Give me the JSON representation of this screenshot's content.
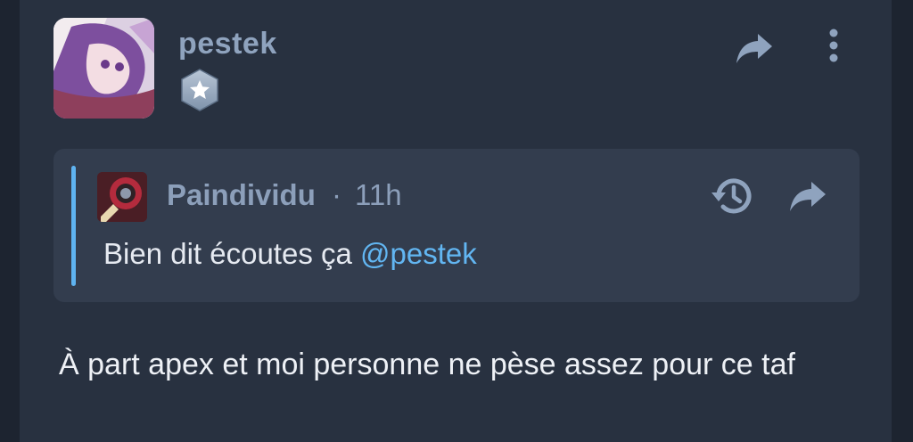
{
  "post": {
    "username": "pestek",
    "badge_icon": "star-badge-icon",
    "share_icon": "share-arrow-icon",
    "more_icon": "more-vertical-icon",
    "body": "À part apex et moi personne ne pèse assez pour ce taf"
  },
  "quote": {
    "author": "Paindividu",
    "separator": "·",
    "time": "11h",
    "text": "Bien dit écoutes ça",
    "mention": "@pestek",
    "history_icon": "history-icon",
    "share_icon": "share-arrow-icon"
  },
  "colors": {
    "background": "#283140",
    "quote_background": "#333d4e",
    "accent": "#5fb3f0",
    "muted": "#8c9fba",
    "text": "#eef1f6"
  }
}
